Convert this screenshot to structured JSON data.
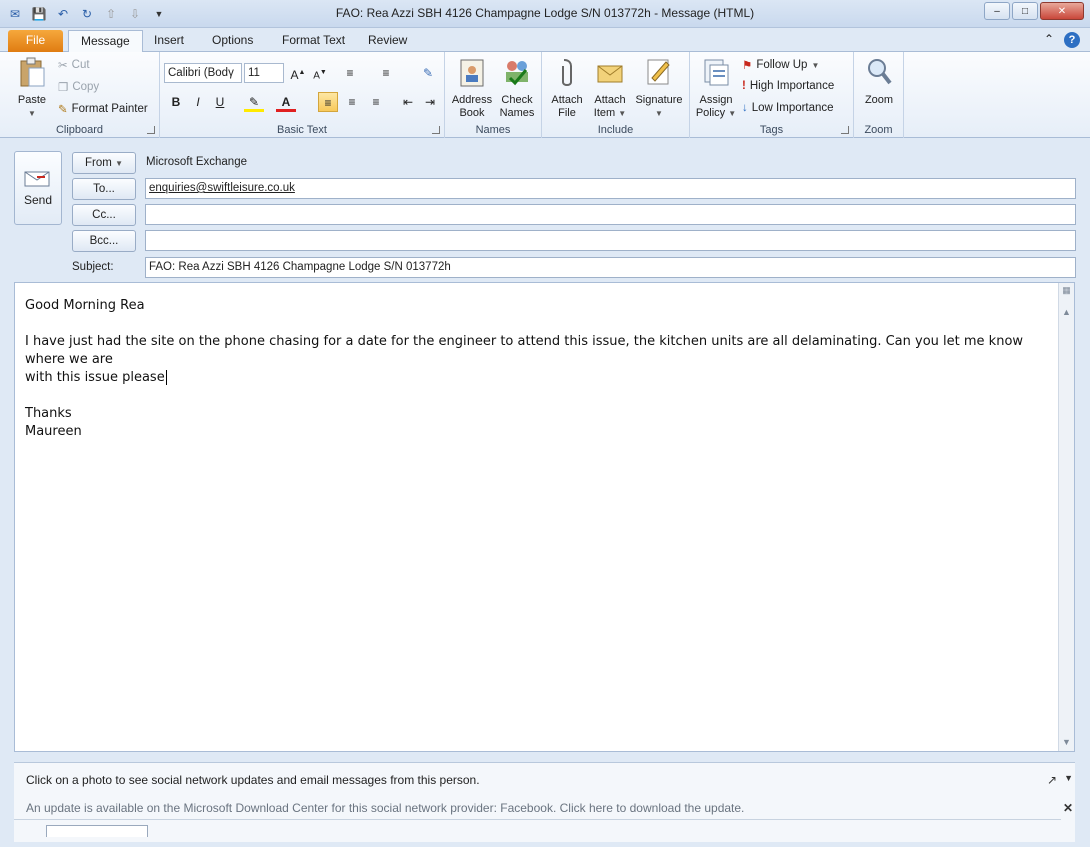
{
  "window": {
    "title": "FAO: Rea Azzi  SBH  4126   Champagne Lodge S/N  013772h  -  Message (HTML)",
    "minimize": "–",
    "restore": "□",
    "close": "✕"
  },
  "tabs": [
    {
      "label": "File"
    },
    {
      "label": "Message"
    },
    {
      "label": "Insert"
    },
    {
      "label": "Options"
    },
    {
      "label": "Format Text"
    },
    {
      "label": "Review"
    }
  ],
  "ribbon": {
    "clipboard": {
      "label": "Clipboard",
      "paste": "Paste",
      "cut": "Cut",
      "copy": "Copy",
      "format_painter": "Format Painter"
    },
    "basic_text": {
      "label": "Basic Text",
      "font": "Calibri (Bodγ",
      "size": "11",
      "bold": "B",
      "italic": "I",
      "underline": "U"
    },
    "names": {
      "label": "Names",
      "address_book": "Address Book",
      "check_names": "Check Names"
    },
    "include": {
      "label": "Include",
      "attach_file": "Attach File",
      "attach_item": "Attach Item",
      "signature": "Signature"
    },
    "tags": {
      "label": "Tags",
      "assign_policy": "Assign Policy",
      "follow_up": "Follow Up",
      "high_importance": "High Importance",
      "low_importance": "Low Importance"
    },
    "zoom": {
      "label": "Zoom",
      "zoom": "Zoom"
    }
  },
  "header": {
    "send": "Send",
    "from_label": "From",
    "from_value": "Microsoft Exchange",
    "to_label": "To...",
    "to_value": "enquiries@swiftleisure.co.uk",
    "cc_label": "Cc...",
    "cc_value": "",
    "bcc_label": "Bcc...",
    "bcc_value": "",
    "subject_label": "Subject:",
    "subject_value": "FAO: Rea Azzi  SBH  4126   Champagne Lodge S/N  013772h"
  },
  "body": {
    "greeting": "Good Morning Rea",
    "line1": "I have just had the site on the phone chasing for a date for the engineer to attend this issue, the kitchen units are all delaminating.  Can you let me know where we are",
    "line2": "with this issue please",
    "thanks": "Thanks",
    "signature": "Maureen"
  },
  "people_pane": {
    "message": "Click on a photo to see social network updates and email messages from this person.",
    "update": "An update is available on the Microsoft Download Center for this social network provider: Facebook. Click here to download the update."
  }
}
